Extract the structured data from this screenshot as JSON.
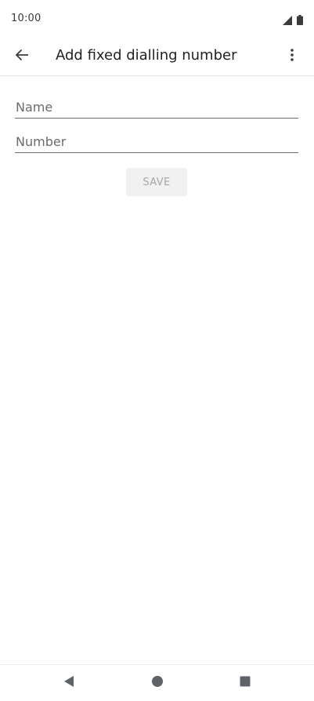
{
  "status_bar": {
    "time": "10:00",
    "icons": [
      "signal-icon",
      "battery-icon"
    ]
  },
  "app_bar": {
    "title": "Add fixed dialling number",
    "back_icon": "arrow-back-icon",
    "overflow_icon": "more-vert-icon"
  },
  "form": {
    "name_placeholder": "Name",
    "name_value": "",
    "number_placeholder": "Number",
    "number_value": "",
    "save_label": "SAVE"
  },
  "nav_bar": {
    "icons": [
      "nav-back-icon",
      "nav-home-icon",
      "nav-recents-icon"
    ]
  },
  "colors": {
    "divider": "#e3e3e3",
    "field_underline": "#6d6d6d",
    "placeholder": "#6b6b6b",
    "save_bg": "#f1f1f1",
    "save_text": "#a6a6a6",
    "icon": "#5f6368"
  }
}
